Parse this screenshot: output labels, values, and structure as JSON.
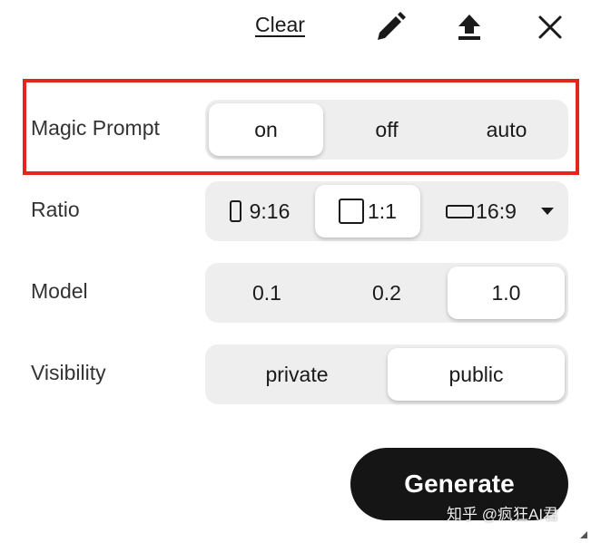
{
  "toolbar": {
    "clear_label": "Clear",
    "icons": [
      "pencil-icon",
      "upload-icon",
      "close-icon"
    ]
  },
  "magic_prompt": {
    "label": "Magic Prompt",
    "options": [
      "on",
      "off",
      "auto"
    ],
    "selected": "on"
  },
  "ratio": {
    "label": "Ratio",
    "options": [
      "9:16",
      "1:1",
      "16:9"
    ],
    "selected": "1:1"
  },
  "model": {
    "label": "Model",
    "options": [
      "0.1",
      "0.2",
      "1.0"
    ],
    "selected": "1.0"
  },
  "visibility": {
    "label": "Visibility",
    "options": [
      "private",
      "public"
    ],
    "selected": "public"
  },
  "generate_label": "Generate",
  "watermark": "知乎 @疯狂AI君",
  "colors": {
    "highlight": "#e3251c",
    "segment_bg": "#eeeeee",
    "button_bg": "#151515"
  }
}
